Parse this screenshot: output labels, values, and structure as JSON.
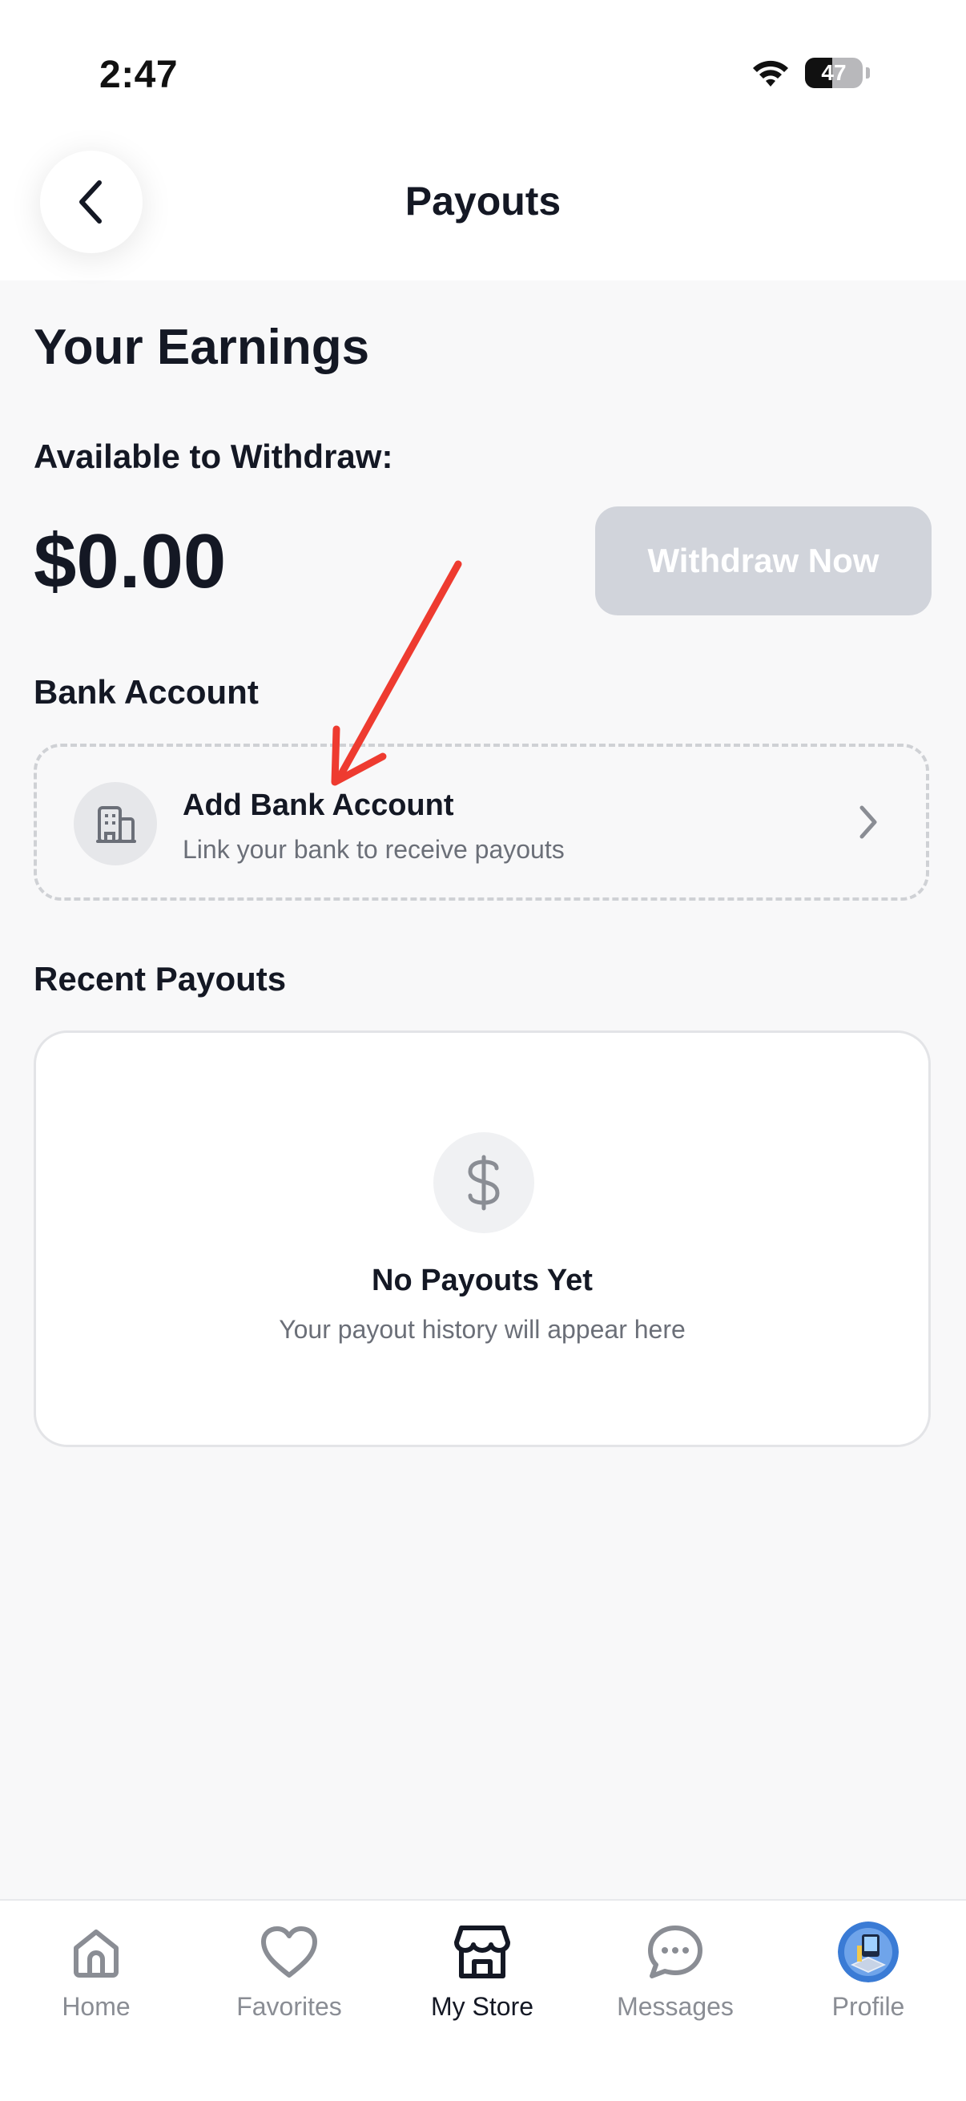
{
  "status_bar": {
    "time": "2:47",
    "battery_level": "47",
    "battery_fraction": 0.47
  },
  "header": {
    "title": "Payouts",
    "back_icon": "chevron-left-icon"
  },
  "earnings": {
    "heading": "Your Earnings",
    "available_label": "Available to Withdraw:",
    "balance": "$0.00",
    "withdraw_label": "Withdraw Now"
  },
  "bank": {
    "section_label": "Bank Account",
    "card_title": "Add Bank Account",
    "card_subtitle": "Link your bank to receive payouts",
    "icon": "bank-building-icon"
  },
  "recent": {
    "section_label": "Recent Payouts",
    "empty_title": "No Payouts Yet",
    "empty_subtitle": "Your payout history will appear here",
    "icon": "dollar-icon"
  },
  "tabs": [
    {
      "label": "Home",
      "icon": "home-icon",
      "active": false
    },
    {
      "label": "Favorites",
      "icon": "heart-icon",
      "active": false
    },
    {
      "label": "My Store",
      "icon": "store-icon",
      "active": true
    },
    {
      "label": "Messages",
      "icon": "chat-bubble-icon",
      "active": false
    },
    {
      "label": "Profile",
      "icon": "avatar",
      "active": false
    }
  ],
  "colors": {
    "background": "#f8f8f9",
    "text_primary": "#141824",
    "text_secondary": "#6b6f78",
    "button_disabled": "#d1d4db",
    "annotation_arrow": "#ee3b30"
  }
}
